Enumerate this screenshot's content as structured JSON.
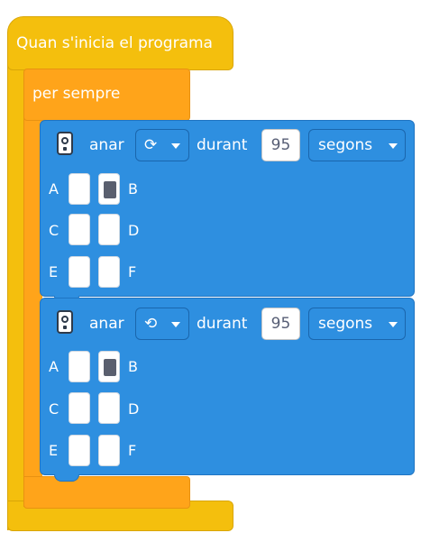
{
  "hat_block": {
    "label": "Quan s'inicia el programa"
  },
  "forever_block": {
    "label": "per sempre"
  },
  "motor_blocks": [
    {
      "label": "anar",
      "direction_icon": "clockwise-icon",
      "direction_glyph": "⟳",
      "during_label": "durant",
      "duration_value": "95",
      "unit": "segons",
      "ports": {
        "A": "A",
        "B": "B",
        "C": "C",
        "D": "D",
        "E": "E",
        "F": "F"
      },
      "selected_port": "B"
    },
    {
      "label": "anar",
      "direction_icon": "counterclockwise-icon",
      "direction_glyph": "⟲",
      "during_label": "durant",
      "duration_value": "95",
      "unit": "segons",
      "ports": {
        "A": "A",
        "B": "B",
        "C": "C",
        "D": "D",
        "E": "E",
        "F": "F"
      },
      "selected_port": "B"
    }
  ],
  "colors": {
    "events": "#f4bf0d",
    "control": "#ffa41a",
    "motors": "#2e8fe0"
  }
}
